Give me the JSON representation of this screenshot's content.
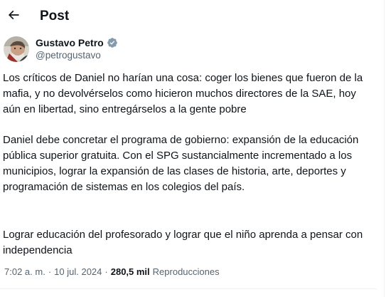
{
  "header": {
    "title": "Post",
    "back_icon": "arrow-left-icon"
  },
  "author": {
    "name": "Gustavo Petro",
    "handle": "@petrogustavo",
    "verified_icon": "verified-badge-icon",
    "verified_color": "#829aab",
    "more_icon": "more-horizontal-icon"
  },
  "post": {
    "paragraphs": [
      "Los críticos de Daniel no harían una cosa: coger los bienes que fueron de la mafia, y no devolvérselos como hicieron muchos directores de la SAE, hoy aún en libertad, sino entregárselos a la gente pobre",
      "Daniel debe concretar el programa de gobierno: expansión de la educación pública superior gratuita. Con el SPG sustancialmente incrementado a los municipios, lograr la expansión de las clases de historia, arte, deportes y programación de sistemas en los colegios del país.",
      "Lograr educación del profesorado y lograr que el niño aprenda a pensar con independencia"
    ]
  },
  "meta": {
    "time": "7:02 a. m.",
    "separator": "·",
    "date": "10 jul. 2024",
    "views_count": "280,5 mil",
    "views_label": "Reproducciones"
  },
  "colors": {
    "text_primary": "#0f1419",
    "text_secondary": "#536471",
    "border": "#eff3f4"
  }
}
